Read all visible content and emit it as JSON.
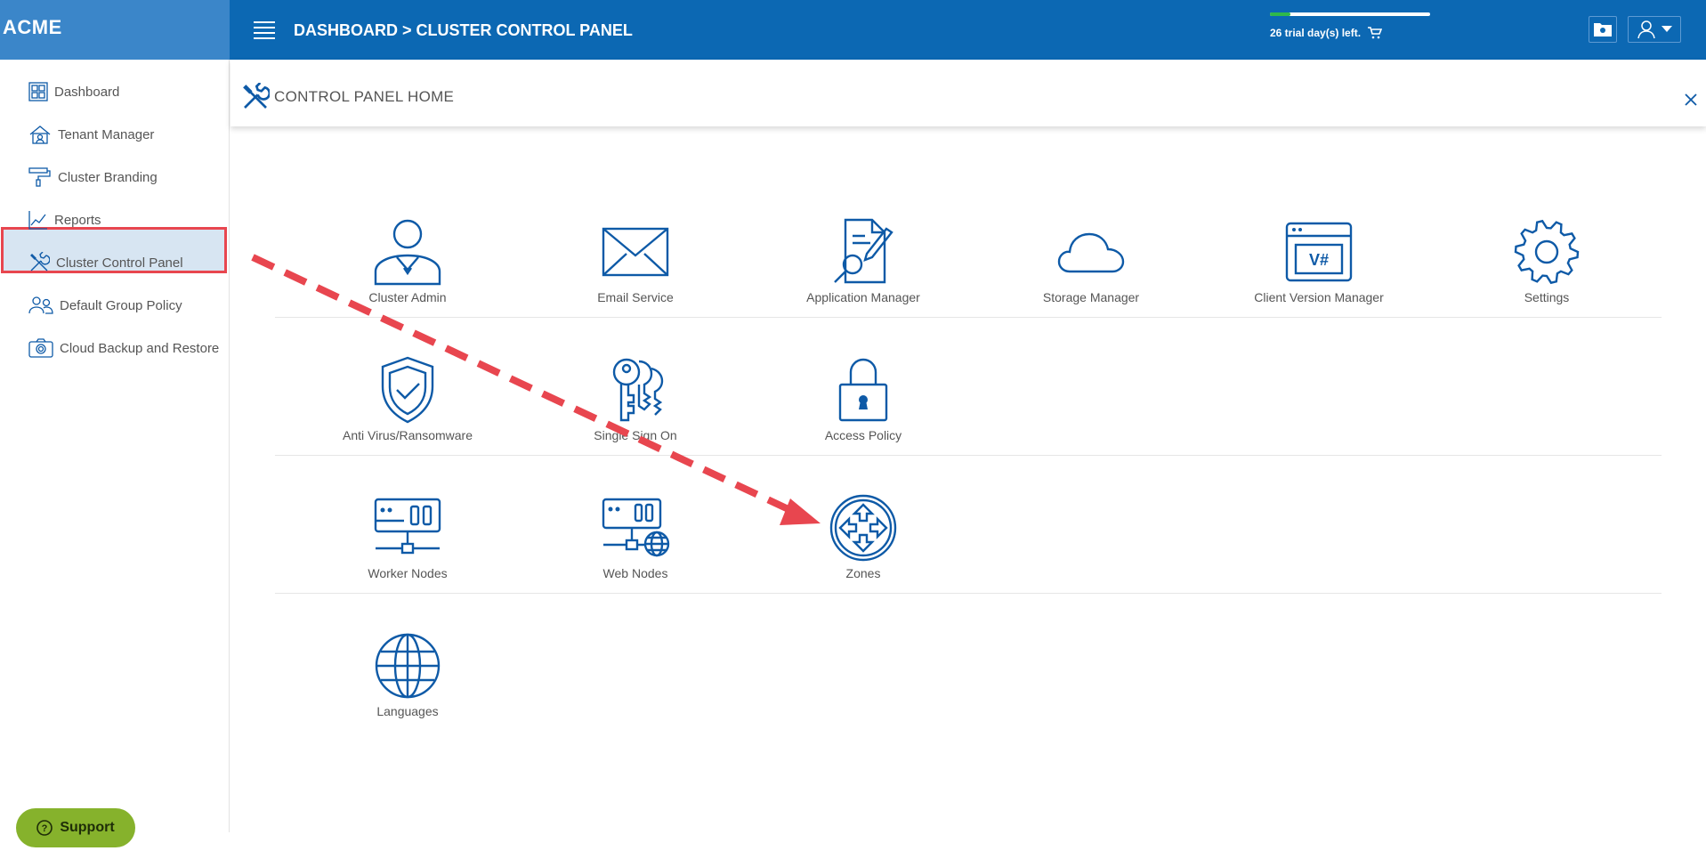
{
  "brand": {
    "name": "ACME"
  },
  "header": {
    "breadcrumb": "DASHBOARD > CLUSTER CONTROL PANEL",
    "trial_text": "26 trial day(s) left.",
    "trial_progress_fraction": 0.13
  },
  "sidebar": {
    "items": [
      {
        "label": "Dashboard",
        "icon": "dashboard-icon"
      },
      {
        "label": "Tenant Manager",
        "icon": "tenant-icon"
      },
      {
        "label": "Cluster Branding",
        "icon": "paint-roller-icon"
      },
      {
        "label": "Reports",
        "icon": "chart-icon"
      },
      {
        "label": "Cluster Control Panel",
        "icon": "tools-icon",
        "active": true
      },
      {
        "label": "Default Group Policy",
        "icon": "users-icon"
      },
      {
        "label": "Cloud Backup and Restore",
        "icon": "camera-icon"
      }
    ]
  },
  "panel": {
    "title": "CONTROL PANEL HOME"
  },
  "tiles": [
    {
      "label": "Cluster Admin",
      "icon": "admin-user-icon"
    },
    {
      "label": "Email Service",
      "icon": "envelope-icon"
    },
    {
      "label": "Application Manager",
      "icon": "app-manager-icon"
    },
    {
      "label": "Storage Manager",
      "icon": "cloud-icon"
    },
    {
      "label": "Client Version Manager",
      "icon": "version-window-icon"
    },
    {
      "label": "Settings",
      "icon": "gear-icon"
    },
    {
      "label": "Anti Virus/Ransomware",
      "icon": "shield-check-icon"
    },
    {
      "label": "Single Sign On",
      "icon": "keys-icon"
    },
    {
      "label": "Access Policy",
      "icon": "lock-icon"
    },
    {
      "label": "Worker Nodes",
      "icon": "server-icon"
    },
    {
      "label": "Web Nodes",
      "icon": "web-server-icon"
    },
    {
      "label": "Zones",
      "icon": "zones-arrows-icon"
    },
    {
      "label": "Languages",
      "icon": "globe-icon"
    }
  ],
  "support": {
    "label": "Support"
  },
  "colors": {
    "brand_blue": "#0c68b3",
    "icon_blue": "#0e5aa7",
    "highlight_red": "#e8464f",
    "support_green": "#86b22c"
  }
}
